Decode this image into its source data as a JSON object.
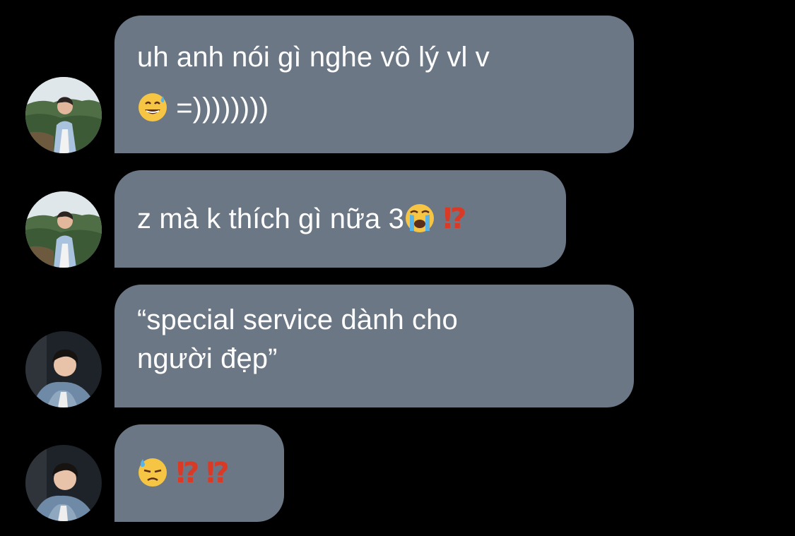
{
  "colors": {
    "background": "#000000",
    "bubble": "#6b7785",
    "text": "#ffffff",
    "exclamation_question": "#d93a26"
  },
  "messages": [
    {
      "sender_avatar": "avatar-boy-landscape",
      "lines": [
        "uh anh nói gì nghe vô lý vl v",
        "=))))))))"
      ],
      "emoji_before_line2": "grinning-sweat-emoji"
    },
    {
      "sender_avatar": "avatar-boy-landscape",
      "text": "z mà k thích gì nữa 3",
      "emojis": [
        "loudly-crying-emoji",
        "exclamation-question-emoji"
      ],
      "exclamation_question": "⁉"
    },
    {
      "sender_avatar": "avatar-boy-denim",
      "lines": [
        "“special service dành cho",
        "người đẹp”"
      ]
    },
    {
      "sender_avatar": "avatar-boy-denim",
      "emojis": [
        "downcast-sweat-emoji",
        "exclamation-question-emoji",
        "exclamation-question-emoji"
      ],
      "exclamation_question": "⁉"
    }
  ]
}
